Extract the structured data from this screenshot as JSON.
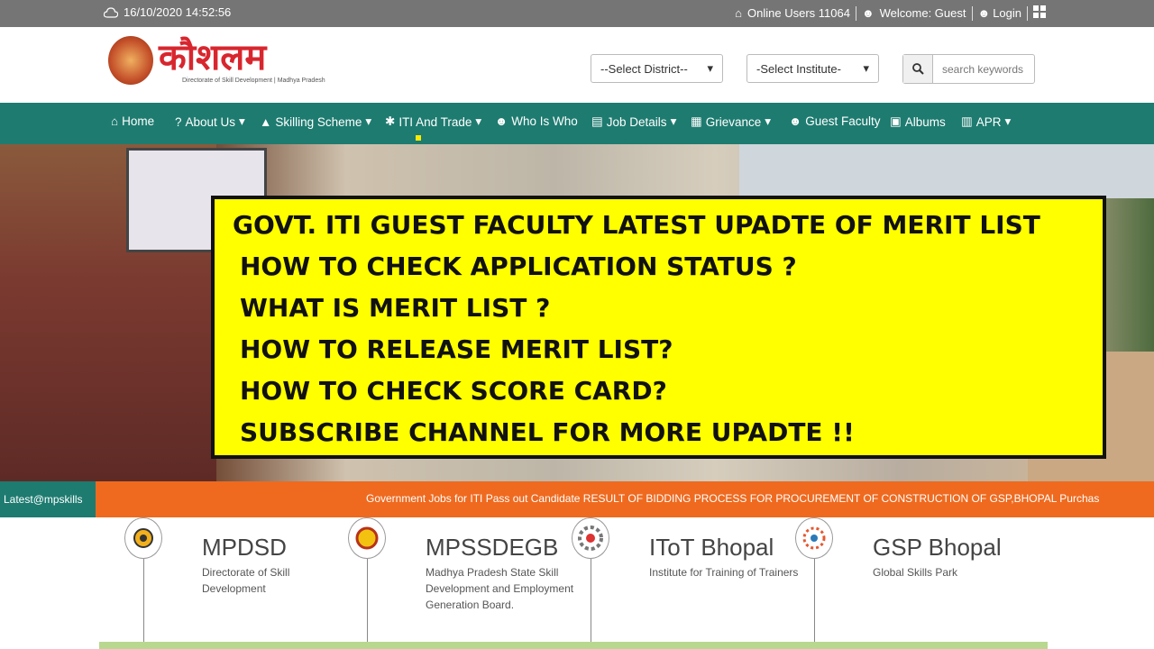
{
  "topbar": {
    "datetime": "16/10/2020 14:52:56",
    "online_users": "Online Users 11064",
    "welcome": "Welcome: Guest",
    "login": "Login"
  },
  "header": {
    "logo_text": "कौशलम",
    "logo_subtext": "Directorate of Skill Development | Madhya Pradesh",
    "district_select": "--Select District--",
    "institute_select": "-Select Institute-",
    "search_placeholder": "search keywords"
  },
  "nav": {
    "items": [
      "Home",
      "About Us",
      "Skilling Scheme",
      "ITI And Trade",
      "Who Is Who",
      "Job Details",
      "Grievance",
      "Guest Faculty",
      "Albums",
      "APR"
    ]
  },
  "banner": {
    "lines": [
      "GOVT. ITI GUEST FACULTY  LATEST UPADTE OF MERIT LIST",
      "HOW TO CHECK APPLICATION STATUS ?",
      "WHAT IS MERIT LIST ?",
      "HOW TO RELEASE MERIT LIST?",
      "HOW TO CHECK SCORE CARD?",
      "SUBSCRIBE CHANNEL FOR MORE UPADTE !!"
    ]
  },
  "ticker": {
    "label": "Latest@mpskills",
    "news": "Government Jobs for ITI Pass out Candidate  RESULT OF BIDDING PROCESS FOR PROCUREMENT OF CONSTRUCTION OF GSP,BHOPAL  Purchas"
  },
  "orgs": [
    {
      "name": "MPDSD",
      "desc": "Directorate of Skill Development"
    },
    {
      "name": "MPSSDEGB",
      "desc": "Madhya Pradesh State Skill Development and Employment Generation Board."
    },
    {
      "name": "IToT Bhopal",
      "desc": "Institute for Training of Trainers"
    },
    {
      "name": "GSP Bhopal",
      "desc": "Global Skills Park"
    }
  ],
  "colors": {
    "topbar": "#757575",
    "nav": "#1e7b70",
    "ticker": "#ef6a1f",
    "banner_box": "#ffff00",
    "logo": "#d8262e"
  }
}
